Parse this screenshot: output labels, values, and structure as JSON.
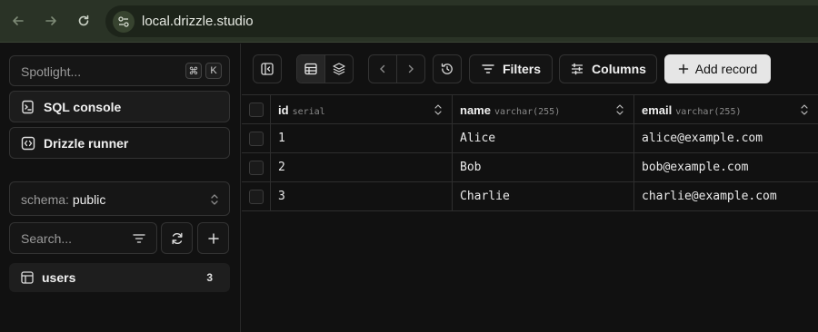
{
  "browser": {
    "url": "local.drizzle.studio",
    "back_icon": "arrow-left-icon",
    "forward_icon": "arrow-right-icon",
    "reload_icon": "reload-icon"
  },
  "sidebar": {
    "spotlight": {
      "label": "Spotlight...",
      "shortcut_mod": "⌘",
      "shortcut_key": "K"
    },
    "sql_console": {
      "label": "SQL console"
    },
    "drizzle_runner": {
      "label": "Drizzle runner"
    },
    "schema": {
      "prefix": "schema:",
      "value": "public"
    },
    "search": {
      "placeholder": "Search..."
    },
    "tables": [
      {
        "name": "users",
        "count": "3"
      }
    ]
  },
  "toolbar": {
    "filters_label": "Filters",
    "columns_label": "Columns",
    "add_record_label": "Add record"
  },
  "grid": {
    "columns": [
      {
        "name": "id",
        "type": "serial"
      },
      {
        "name": "name",
        "type": "varchar(255)"
      },
      {
        "name": "email",
        "type": "varchar(255)"
      }
    ],
    "rows": [
      {
        "id": "1",
        "name": "Alice",
        "email": "alice@example.com"
      },
      {
        "id": "2",
        "name": "Bob",
        "email": "bob@example.com"
      },
      {
        "id": "3",
        "name": "Charlie",
        "email": "charlie@example.com"
      }
    ]
  },
  "colors": {
    "browser_bar": "#2a3326",
    "background": "#111111",
    "border": "#333333",
    "add_button": "#e6e6e6"
  }
}
